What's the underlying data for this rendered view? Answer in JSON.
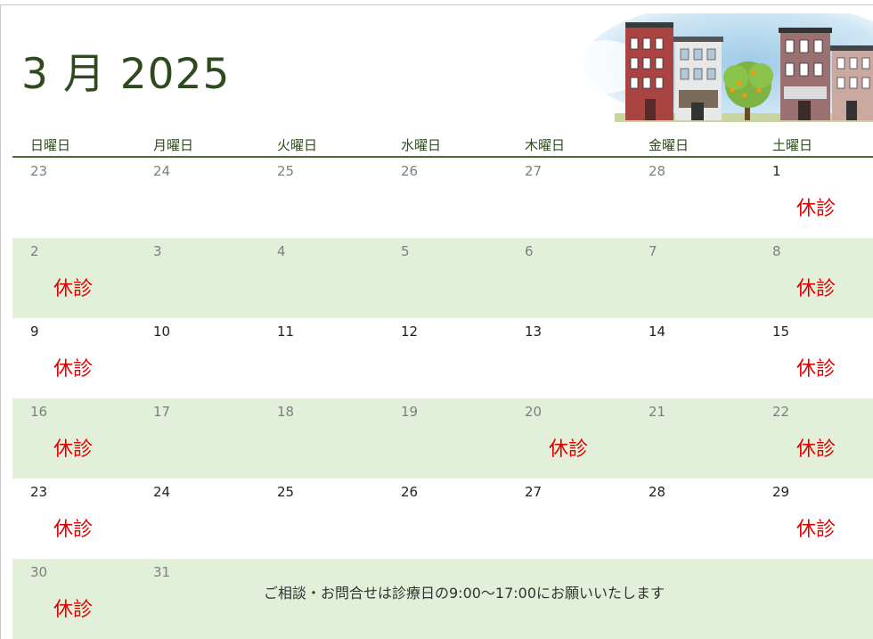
{
  "calendar": {
    "title": "3 月 2025",
    "weekdays": [
      "日曜日",
      "月曜日",
      "火曜日",
      "水曜日",
      "木曜日",
      "金曜日",
      "土曜日"
    ],
    "closed_label": "休診",
    "weeks": [
      {
        "days": [
          "23",
          "24",
          "25",
          "26",
          "27",
          "28",
          "1"
        ]
      },
      {
        "days": [
          "2",
          "3",
          "4",
          "5",
          "6",
          "7",
          "8"
        ]
      },
      {
        "days": [
          "9",
          "10",
          "11",
          "12",
          "13",
          "14",
          "15"
        ]
      },
      {
        "days": [
          "16",
          "17",
          "18",
          "19",
          "20",
          "21",
          "22"
        ]
      },
      {
        "days": [
          "23",
          "24",
          "25",
          "26",
          "27",
          "28",
          "29"
        ]
      },
      {
        "days": [
          "30",
          "31"
        ]
      }
    ],
    "note": "ご相談・お問合せは診療日の9:00～17:00にお願いいたします"
  },
  "colors": {
    "title": "#2e4a1e",
    "shaded_row": "#e2efd9",
    "closed_text": "#e00000",
    "header_rule": "#4f6b33"
  },
  "banner": {
    "icon": "townhouses-illustration"
  }
}
